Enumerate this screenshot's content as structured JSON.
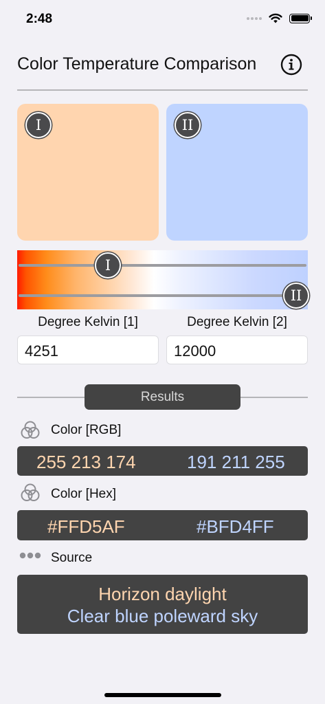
{
  "status_bar": {
    "time": "2:48"
  },
  "header": {
    "title": "Color Temperature Comparison",
    "info_icon": "info-circle-icon"
  },
  "swatches": [
    {
      "marker": "I",
      "color": "#FFD5AF"
    },
    {
      "marker": "II",
      "color": "#BFD4FF"
    }
  ],
  "sliders": [
    {
      "marker": "I",
      "value_kelvin": 4251
    },
    {
      "marker": "II",
      "value_kelvin": 12000
    }
  ],
  "inputs": {
    "label_1": "Degree Kelvin [1]",
    "label_2": "Degree Kelvin [2]",
    "value_1": "4251",
    "value_2": "12000"
  },
  "results": {
    "button_label": "Results",
    "rgb": {
      "label": "Color [RGB]",
      "icon": "color-circles-icon",
      "value_1": "255 213 174",
      "value_2": "191 211 255"
    },
    "hex": {
      "label": "Color [Hex]",
      "icon": "color-circles-icon",
      "value_1": "#FFD5AF",
      "value_2": "#BFD4FF"
    },
    "source": {
      "label": "Source",
      "icon": "ellipsis-icon",
      "value_1": "Horizon daylight",
      "value_2": "Clear blue poleward sky"
    }
  },
  "colors": {
    "warm": "#FFD5AF",
    "cool": "#BFD4FF",
    "dark_bar": "#434343",
    "background": "#F2F1F6"
  }
}
